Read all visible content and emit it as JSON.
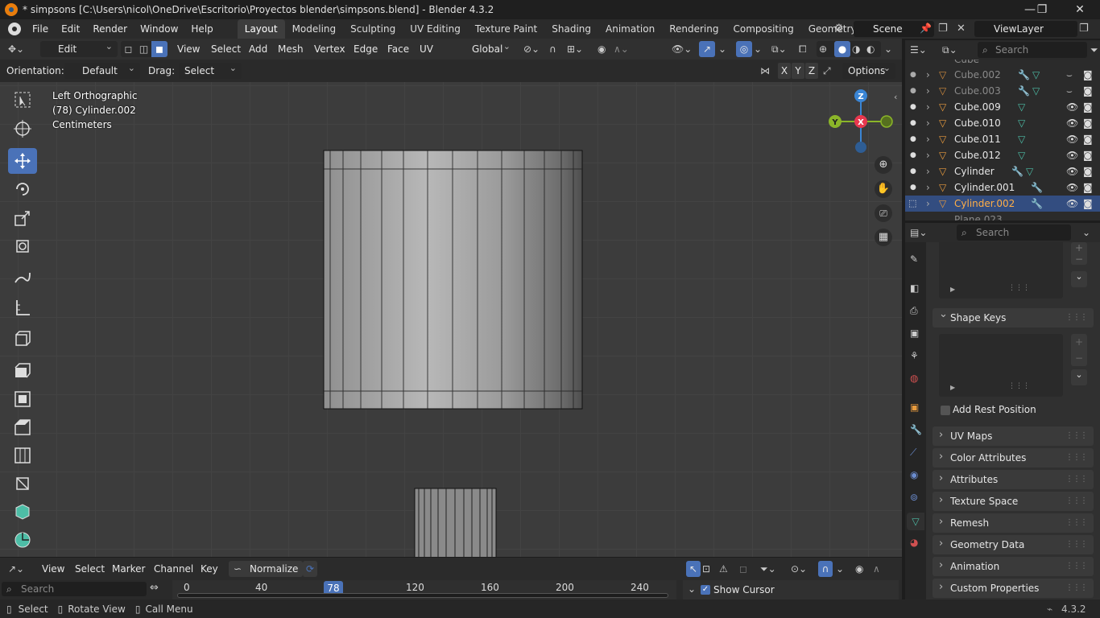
{
  "window": {
    "title": "* simpsons [C:\\Users\\nicol\\OneDrive\\Escritorio\\Proyectos blender\\simpsons.blend] - Blender 4.3.2",
    "controls": {
      "minimize": "—",
      "maximize": "❐",
      "close": "✕"
    }
  },
  "menu": [
    "File",
    "Edit",
    "Render",
    "Window",
    "Help"
  ],
  "workspaces": [
    "Layout",
    "Modeling",
    "Sculpting",
    "UV Editing",
    "Texture Paint",
    "Shading",
    "Animation",
    "Rendering",
    "Compositing",
    "Geometry Node"
  ],
  "active_workspace": "Layout",
  "scene": {
    "name": "Scene",
    "view_layer": "ViewLayer"
  },
  "viewport_header": {
    "mode": "Edit Mode",
    "menus": [
      "View",
      "Select",
      "Add",
      "Mesh",
      "Vertex",
      "Edge",
      "Face",
      "UV"
    ],
    "transform": "Global",
    "orientation_label": "Orientation:",
    "orientation_value": "Default",
    "drag_label": "Drag:",
    "drag_value": "Select Box",
    "axes": [
      "X",
      "Y",
      "Z"
    ],
    "options": "Options"
  },
  "viewport_info": {
    "view": "Left Orthographic",
    "object": "(78) Cylinder.002",
    "units": "Centimeters"
  },
  "gizmo": {
    "z": "Z",
    "y": "Y",
    "x": "X"
  },
  "outliner": {
    "search_placeholder": "Search",
    "rows": [
      {
        "name": "Cube.002",
        "dim": true
      },
      {
        "name": "Cube.003",
        "dim": true
      },
      {
        "name": "Cube.009",
        "dim": false
      },
      {
        "name": "Cube.010",
        "dim": false
      },
      {
        "name": "Cube.011",
        "dim": false
      },
      {
        "name": "Cube.012",
        "dim": false
      },
      {
        "name": "Cylinder",
        "dim": false
      },
      {
        "name": "Cylinder.001",
        "dim": false
      },
      {
        "name": "Cylinder.002",
        "dim": false,
        "selected": true
      }
    ],
    "partial_top": "Cube",
    "partial_bottom": "Plane.023"
  },
  "properties": {
    "search_placeholder": "Search",
    "shape_keys": "Shape Keys",
    "add_rest_position": "Add Rest Position",
    "panels": [
      "UV Maps",
      "Color Attributes",
      "Attributes",
      "Texture Space",
      "Remesh",
      "Geometry Data",
      "Animation",
      "Custom Properties"
    ]
  },
  "timeline": {
    "menus": [
      "View",
      "Select",
      "Marker",
      "Channel",
      "Key"
    ],
    "normalize": "Normalize",
    "search_placeholder": "Search",
    "ticks": [
      "0",
      "40",
      "120",
      "160",
      "200",
      "240"
    ],
    "current_frame": "78",
    "show_cursor": "Show Cursor"
  },
  "statusbar": {
    "select": "Select",
    "rotate": "Rotate View",
    "call_menu": "Call Menu",
    "version": "4.3.2"
  },
  "colors": {
    "accent": "#4a72b8",
    "selected_object": "#ffae47",
    "x_axis": "#e8384f",
    "y_axis": "#8bb529",
    "z_axis": "#3a85d4"
  }
}
